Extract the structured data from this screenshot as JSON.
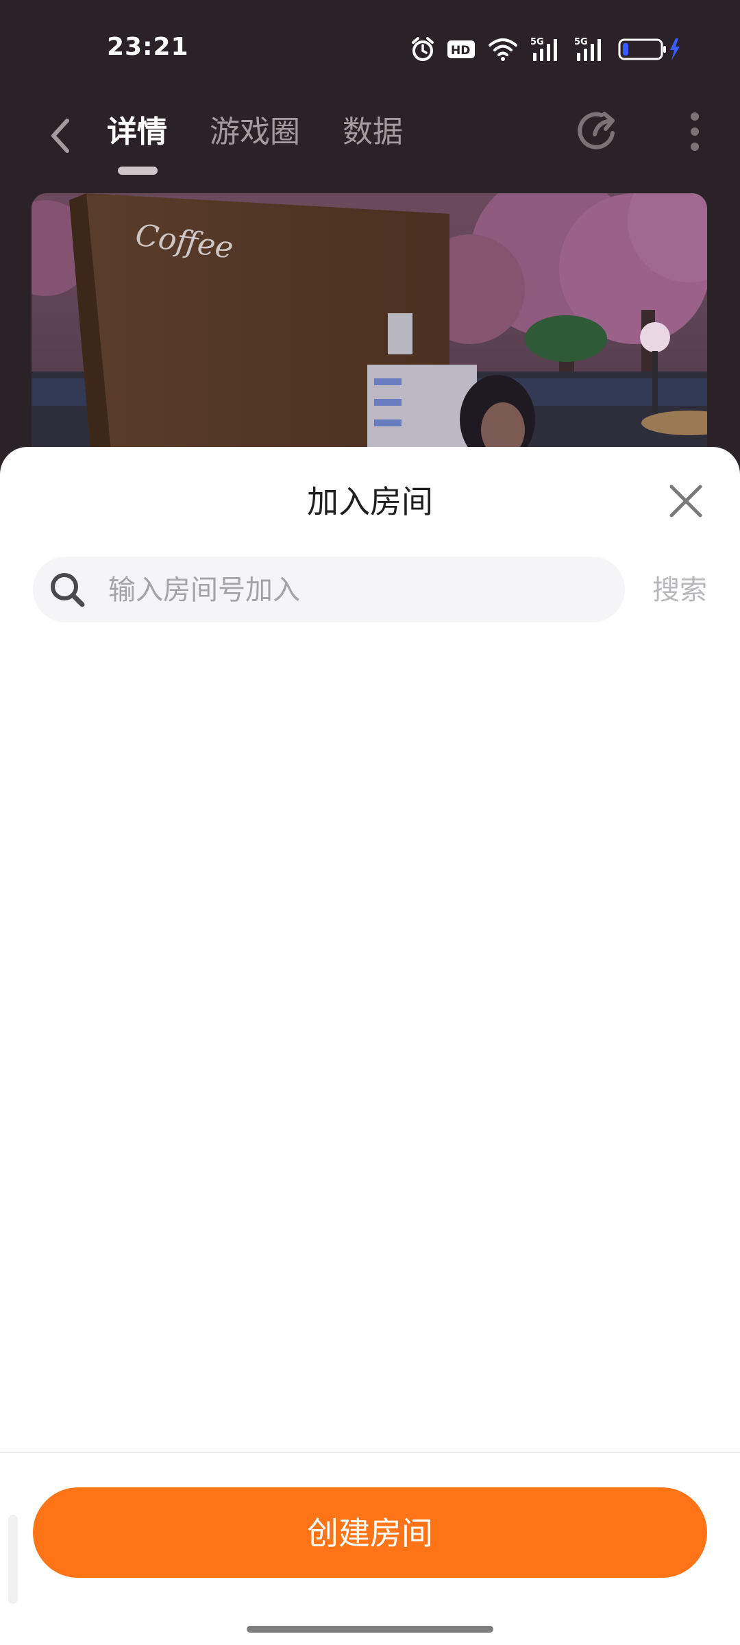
{
  "status_bar": {
    "time": "23:21",
    "network_1": "5G",
    "network_2": "5G",
    "hd_label": "HD"
  },
  "nav": {
    "tabs": [
      {
        "label": "详情",
        "active": true
      },
      {
        "label": "游戏圈",
        "active": false
      },
      {
        "label": "数据",
        "active": false
      }
    ]
  },
  "banner": {
    "sign_text": "Coffee"
  },
  "sheet": {
    "title": "加入房间",
    "search_placeholder": "输入房间号加入",
    "search_button": "搜索",
    "create_button": "创建房间"
  },
  "colors": {
    "accent": "#ff7417",
    "backdrop": "#2b2227",
    "sheet_bg": "#ffffff"
  }
}
